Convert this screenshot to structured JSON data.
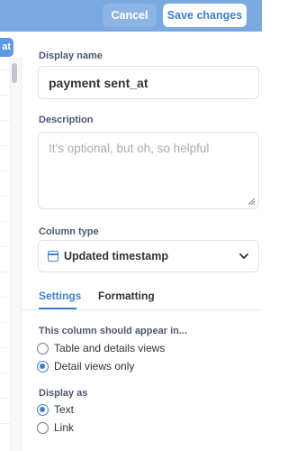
{
  "header": {
    "cancel_label": "Cancel",
    "save_label": "Save changes"
  },
  "sidebar": {
    "chip_label": "at"
  },
  "form": {
    "display_name": {
      "label": "Display name",
      "value": "payment sent_at"
    },
    "description": {
      "label": "Description",
      "placeholder": "It’s optional, but oh, so helpful"
    },
    "column_type": {
      "label": "Column type",
      "icon": "calendar-icon",
      "selected": "Updated timestamp"
    }
  },
  "tabs": [
    {
      "label": "Settings",
      "active": true
    },
    {
      "label": "Formatting",
      "active": false
    }
  ],
  "settings": {
    "visibility": {
      "label": "This column should appear in...",
      "options": [
        {
          "label": "Table and details views",
          "selected": false
        },
        {
          "label": "Detail views only",
          "selected": true
        }
      ]
    },
    "display_as": {
      "label": "Display as",
      "options": [
        {
          "label": "Text",
          "selected": true
        },
        {
          "label": "Link",
          "selected": false
        }
      ]
    }
  },
  "colors": {
    "brand": "#3f7fd1",
    "header_bg": "#7aa8e0"
  }
}
